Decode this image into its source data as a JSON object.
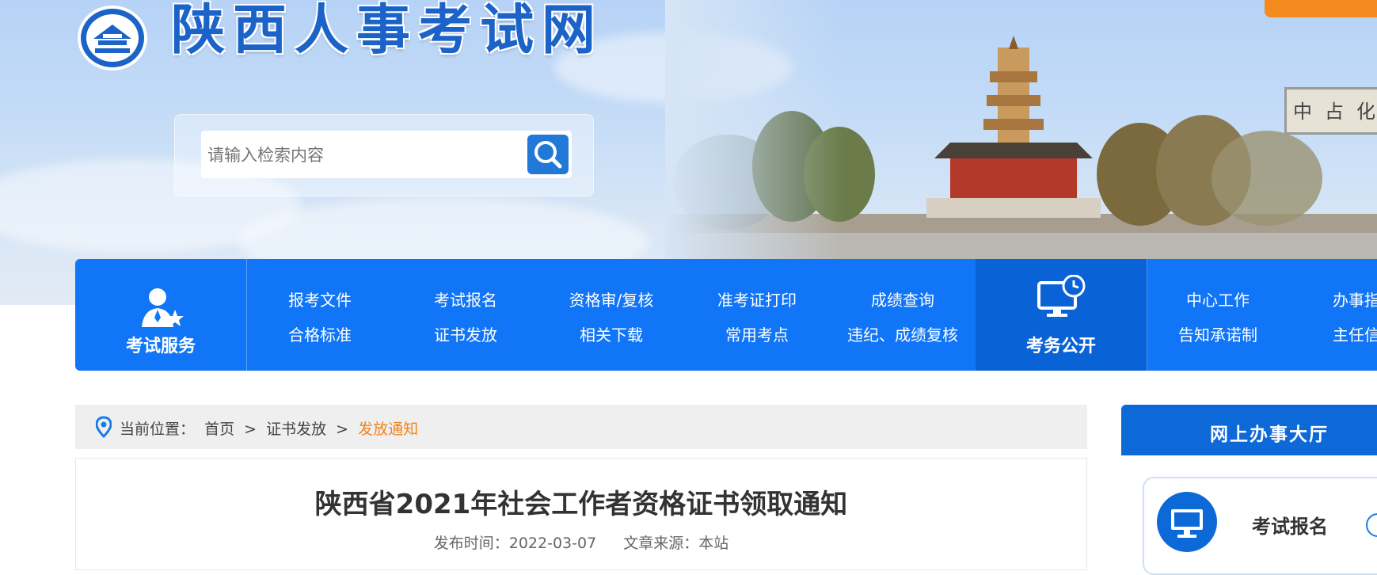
{
  "header": {
    "site_title": "陕西人事考试网",
    "search_placeholder": "请输入检索内容",
    "plaque_chars": [
      "中",
      "占",
      "化"
    ]
  },
  "nav": {
    "service_label": "考试服务",
    "links_row1": [
      "报考文件",
      "考试报名",
      "资格审/复核",
      "准考证打印",
      "成绩查询"
    ],
    "links_row2": [
      "合格标准",
      "证书发放",
      "相关下载",
      "常用考点",
      "违纪、成绩复核"
    ],
    "public_label": "考务公开",
    "right_row1": [
      "中心工作",
      "办事指南"
    ],
    "right_row2": [
      "告知承诺制",
      "主任信箱"
    ]
  },
  "breadcrumb": {
    "label": "当前位置：",
    "home": "首页",
    "sep": ">",
    "section": "证书发放",
    "current": "发放通知"
  },
  "article": {
    "title": "陕西省2021年社会工作者资格证书领取通知",
    "publish_label": "发布时间：2022-03-07",
    "source_label": "文章来源：本站"
  },
  "sidebar": {
    "header": "网上办事大厅",
    "card_label": "考试报名"
  },
  "colors": {
    "nav_blue": "#1075f7",
    "accent_orange": "#f08418",
    "title_blue": "#1b63c8"
  }
}
